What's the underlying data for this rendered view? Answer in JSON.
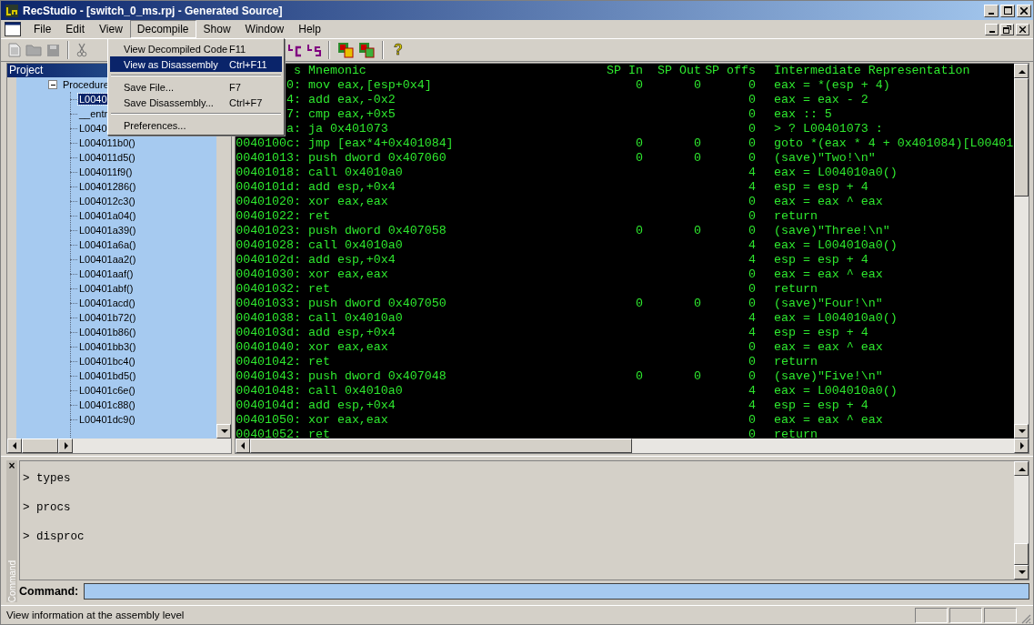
{
  "window": {
    "title": "RecStudio - [switch_0_ms.rpj - Generated Source]"
  },
  "menu_bar": [
    {
      "label": "File",
      "selected": false
    },
    {
      "label": "Edit",
      "selected": false
    },
    {
      "label": "View",
      "selected": false
    },
    {
      "label": "Decompile",
      "selected": true
    },
    {
      "label": "Show",
      "selected": false
    },
    {
      "label": "Window",
      "selected": false
    },
    {
      "label": "Help",
      "selected": false
    }
  ],
  "toolbar": [
    {
      "kind": "new"
    },
    {
      "kind": "open"
    },
    {
      "kind": "save"
    },
    {
      "kind": "sep"
    },
    {
      "kind": "cut"
    },
    {
      "kind": "gap"
    },
    {
      "kind": "decompile-c"
    },
    {
      "kind": "decompile-s"
    },
    {
      "kind": "sep"
    },
    {
      "kind": "chip-c"
    },
    {
      "kind": "chip-s"
    },
    {
      "kind": "sep"
    },
    {
      "kind": "help",
      "glyph": "?"
    }
  ],
  "dropdown": [
    {
      "kind": "item",
      "label": "View Decompiled Code",
      "shortcut": "F11",
      "selected": false
    },
    {
      "kind": "item",
      "label": "View as Disassembly",
      "shortcut": "Ctrl+F11",
      "selected": true
    },
    {
      "kind": "separator"
    },
    {
      "kind": "item",
      "label": "Save File...",
      "shortcut": "F7",
      "selected": false
    },
    {
      "kind": "item",
      "label": "Save Disassembly...",
      "shortcut": "Ctrl+F7",
      "selected": false
    },
    {
      "kind": "separator"
    },
    {
      "kind": "item",
      "label": "Preferences...",
      "selected": false
    }
  ],
  "project": {
    "title": "Project",
    "tree": [
      {
        "label": "Procedure",
        "expanded": true,
        "children": [
          {
            "label": "L0040",
            "selected": true
          },
          {
            "label": "__entr",
            "selected": false
          },
          {
            "label": "L0040",
            "selected": false
          },
          {
            "label": "L004011b0()",
            "selected": false
          },
          {
            "label": "L004011d5()",
            "selected": false
          },
          {
            "label": "L004011f9()",
            "selected": false
          },
          {
            "label": "L00401286()",
            "selected": false
          },
          {
            "label": "L004012c3()",
            "selected": false
          },
          {
            "label": "L00401a04()",
            "selected": false
          },
          {
            "label": "L00401a39()",
            "selected": false
          },
          {
            "label": "L00401a6a()",
            "selected": false
          },
          {
            "label": "L00401aa2()",
            "selected": false
          },
          {
            "label": "L00401aaf()",
            "selected": false
          },
          {
            "label": "L00401abf()",
            "selected": false
          },
          {
            "label": "L00401acd()",
            "selected": false
          },
          {
            "label": "L00401b72()",
            "selected": false
          },
          {
            "label": "L00401b86()",
            "selected": false
          },
          {
            "label": "L00401bb3()",
            "selected": false
          },
          {
            "label": "L00401bc4()",
            "selected": false
          },
          {
            "label": "L00401bd5()",
            "selected": false
          },
          {
            "label": "L00401c6e()",
            "selected": false
          },
          {
            "label": "L00401c88()",
            "selected": false
          },
          {
            "label": "L00401dc9()",
            "selected": false
          }
        ]
      }
    ]
  },
  "disassembly": {
    "columns": [
      "s",
      "Mnemonic",
      "SP In",
      "SP Out",
      "SP offs",
      "Intermediate Representation"
    ],
    "rows": [
      {
        "address": "0:",
        "mnemonic": "mov eax,[esp+0x4]",
        "sp_in": "0",
        "sp_out": "0",
        "sp_offs": "0",
        "ir": "eax = *(esp + 4)"
      },
      {
        "address": "4:",
        "mnemonic": "add eax,-0x2",
        "sp_offs": "0",
        "ir": "eax = eax - 2"
      },
      {
        "address": "7:",
        "mnemonic": "cmp eax,+0x5",
        "sp_offs": "0",
        "ir": "eax :: 5"
      },
      {
        "address": "a:",
        "mnemonic": "ja 0x401073",
        "sp_offs": "0",
        "ir": "> ? L00401073 :"
      },
      {
        "address": "0040100c:",
        "mnemonic": "jmp [eax*4+0x401084]",
        "sp_in": "0",
        "sp_out": "0",
        "sp_offs": "0",
        "ir": "goto *(eax * 4 + 0x401084)[L00401"
      },
      {
        "address": "00401013:",
        "mnemonic": "push dword 0x407060",
        "sp_in": "0",
        "sp_out": "0",
        "sp_offs": "0",
        "ir": "(save)\"Two!\\n\""
      },
      {
        "address": "00401018:",
        "mnemonic": "call 0x4010a0",
        "sp_offs": "4",
        "ir": "eax = L004010a0()"
      },
      {
        "address": "0040101d:",
        "mnemonic": "add esp,+0x4",
        "sp_offs": "4",
        "ir": "esp = esp + 4"
      },
      {
        "address": "00401020:",
        "mnemonic": "xor eax,eax",
        "sp_offs": "0",
        "ir": "eax = eax ^ eax"
      },
      {
        "address": "00401022:",
        "mnemonic": "ret",
        "sp_offs": "0",
        "ir": "return"
      },
      {
        "address": "00401023:",
        "mnemonic": "push dword 0x407058",
        "sp_in": "0",
        "sp_out": "0",
        "sp_offs": "0",
        "ir": "(save)\"Three!\\n\""
      },
      {
        "address": "00401028:",
        "mnemonic": "call 0x4010a0",
        "sp_offs": "4",
        "ir": "eax = L004010a0()"
      },
      {
        "address": "0040102d:",
        "mnemonic": "add esp,+0x4",
        "sp_offs": "4",
        "ir": "esp = esp + 4"
      },
      {
        "address": "00401030:",
        "mnemonic": "xor eax,eax",
        "sp_offs": "0",
        "ir": "eax = eax ^ eax"
      },
      {
        "address": "00401032:",
        "mnemonic": "ret",
        "sp_offs": "0",
        "ir": "return"
      },
      {
        "address": "00401033:",
        "mnemonic": "push dword 0x407050",
        "sp_in": "0",
        "sp_out": "0",
        "sp_offs": "0",
        "ir": "(save)\"Four!\\n\""
      },
      {
        "address": "00401038:",
        "mnemonic": "call 0x4010a0",
        "sp_offs": "4",
        "ir": "eax = L004010a0()"
      },
      {
        "address": "0040103d:",
        "mnemonic": "add esp,+0x4",
        "sp_offs": "4",
        "ir": "esp = esp + 4"
      },
      {
        "address": "00401040:",
        "mnemonic": "xor eax,eax",
        "sp_offs": "0",
        "ir": "eax = eax ^ eax"
      },
      {
        "address": "00401042:",
        "mnemonic": "ret",
        "sp_offs": "0",
        "ir": "return"
      },
      {
        "address": "00401043:",
        "mnemonic": "push dword 0x407048",
        "sp_in": "0",
        "sp_out": "0",
        "sp_offs": "0",
        "ir": "(save)\"Five!\\n\""
      },
      {
        "address": "00401048:",
        "mnemonic": "call 0x4010a0",
        "sp_offs": "4",
        "ir": "eax = L004010a0()"
      },
      {
        "address": "0040104d:",
        "mnemonic": "add esp,+0x4",
        "sp_offs": "4",
        "ir": "esp = esp + 4"
      },
      {
        "address": "00401050:",
        "mnemonic": "xor eax,eax",
        "sp_offs": "0",
        "ir": "eax = eax ^ eax"
      },
      {
        "address": "00401052:",
        "mnemonic": "ret",
        "sp_offs": "0",
        "ir": "return"
      }
    ]
  },
  "command_panel": {
    "title": "Command",
    "close": "×",
    "output": [
      "> types",
      "> procs",
      "> disproc"
    ],
    "prompt_label": "Command:"
  },
  "status_bar": {
    "text": "View information at the assembly level"
  }
}
